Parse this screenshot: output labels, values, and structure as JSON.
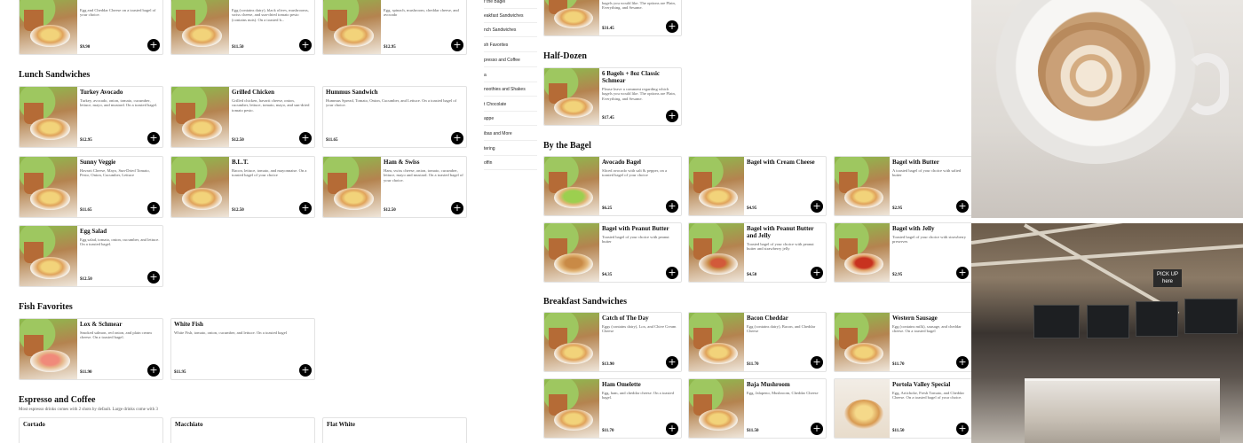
{
  "nav": {
    "items": [
      "r the Bagel",
      "eakfast Sandwiches",
      "nch Sandwiches",
      "sh Favorites",
      "presso and Coffee",
      "a",
      "noothies and Shakes",
      "t Chocolate",
      "appe",
      "ibas and More",
      "tering",
      "offin"
    ]
  },
  "left": {
    "top_cards": [
      {
        "name": "",
        "desc": "Egg and Cheddar Cheese on a toasted bagel of your choice.",
        "price": "$9.90"
      },
      {
        "name": "",
        "desc": "Egg (contains dairy), black olives, mushrooms, swiss cheese, and sun-dried tomato pesto (contains nuts). On a toasted b...",
        "price": "$11.50"
      },
      {
        "name": "",
        "desc": "Egg, spinach, mushroom, cheddar cheese, and avocado",
        "price": "$12.95"
      }
    ],
    "lunch": {
      "title": "Lunch Sandwiches",
      "cards": [
        {
          "name": "Turkey Avocado",
          "desc": "Turkey, avocado, onion, tomato, cucumber, lettuce, mayo, and mustard. On a toasted bagel.",
          "price": "$12.95"
        },
        {
          "name": "Grilled Chicken",
          "desc": "Grilled chicken, havarti cheese, onion, cucumber, lettuce, tomato, mayo, and sun-dried tomato pesto.",
          "price": "$12.50"
        },
        {
          "name": "Hummus Sandwich",
          "desc": "Hummus Spread, Tomato, Onion, Cucumber, and Lettuce. On a toasted bagel of your choice.",
          "price": "$11.65"
        },
        {
          "name": "Sunny Veggie",
          "desc": "Havarti Cheese, Mayo, Sun-Dried Tomato, Pesto, Onion, Cucumber, Lettuce",
          "price": "$11.65"
        },
        {
          "name": "B.L.T.",
          "desc": "Bacon, lettuce, tomato, and mayonnaise. On a toasted bagel of your choice",
          "price": "$12.50"
        },
        {
          "name": "Ham & Swiss",
          "desc": "Ham, swiss cheese, onion, tomato, cucumber, lettuce, mayo and mustard. On a toasted bagel of your choice.",
          "price": "$12.50"
        },
        {
          "name": "Egg Salad",
          "desc": "Egg salad, tomato, onion, cucumber, and lettuce. On a toasted bagel.",
          "price": "$12.50"
        }
      ]
    },
    "fish": {
      "title": "Fish Favorites",
      "cards": [
        {
          "name": "Lox & Schmear",
          "desc": "Smoked salmon, red onion, and plain cream cheese. On a toasted bagel.",
          "price": "$11.90"
        },
        {
          "name": "White Fish",
          "desc": "White Fish, tomato, onion, cucumber, and lettuce. On a toasted bagel",
          "price": "$11.95"
        }
      ]
    },
    "espresso": {
      "title": "Espresso and Coffee",
      "subtitle": "Most espresso drinks comes with 2 shots by default. Large drinks come with 3",
      "cards": [
        {
          "name": "Cortado"
        },
        {
          "name": "Macchiato"
        },
        {
          "name": "Flat White"
        }
      ]
    }
  },
  "right": {
    "top_card": {
      "desc": "bagels you would like. The options are Plain, Everything, and Sesame.",
      "price": "$31.45"
    },
    "half_dozen": {
      "title": "Half-Dozen",
      "card": {
        "name": "6 Bagels + 8oz Classic Schmear",
        "desc": "Please leave a comment regarding which bagels you would like. The options are Plain, Everything, and Sesame.",
        "price": "$17.45"
      }
    },
    "by_bagel": {
      "title": "By the Bagel",
      "cards": [
        {
          "name": "Avocado Bagel",
          "desc": "Sliced avocado with salt & pepper, on a toasted bagel of your choice",
          "price": "$6.25"
        },
        {
          "name": "Bagel with Cream Cheese",
          "desc": "",
          "price": "$4.95"
        },
        {
          "name": "Bagel with Butter",
          "desc": "A toasted bagel of your choice with salted butter",
          "price": "$2.95"
        },
        {
          "name": "Bagel with Peanut Butter",
          "desc": "Toasted bagel of your choice with peanut butter",
          "price": "$4.35"
        },
        {
          "name": "Bagel with Peanut Butter and Jelly",
          "desc": "Toasted bagel of your choice with peanut butter and strawberry jelly",
          "price": "$4.50"
        },
        {
          "name": "Bagel with Jelly",
          "desc": "Toasted bagel of your choice with strawberry preserves",
          "price": "$2.95"
        }
      ]
    },
    "breakfast": {
      "title": "Breakfast Sandwiches",
      "cards": [
        {
          "name": "Catch of The Day",
          "desc": "Eggs (contains dairy), Lox, and Chive Cream Cheese",
          "price": "$13.90"
        },
        {
          "name": "Bacon Cheddar",
          "desc": "Egg (contains dairy), Bacon, and Cheddar Cheese",
          "price": "$11.70"
        },
        {
          "name": "Western Sausage",
          "desc": "Egg (contains milk), sausage, and cheddar cheese. On a toasted bagel",
          "price": "$11.70"
        },
        {
          "name": "Ham Omelette",
          "desc": "Egg, ham, and cheddar cheese. On a toasted bagel.",
          "price": "$11.70"
        },
        {
          "name": "Baja Mushroom",
          "desc": "Egg, Jalapeno, Mushroom, Cheddar Cheese",
          "price": "$11.50"
        },
        {
          "name": "Portola Valley Special",
          "desc": "Egg, Artichoke, Fresh Tomato, and Cheddar Cheese. On a toasted bagel of your choice.",
          "price": "$11.50"
        }
      ]
    }
  },
  "photos": {
    "store": {
      "pickup_sign": "PICK UP\nhere"
    }
  }
}
